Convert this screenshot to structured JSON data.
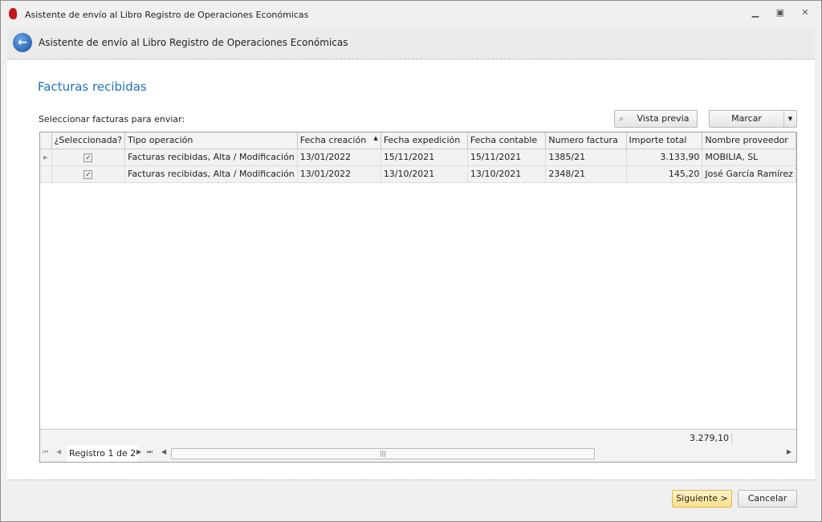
{
  "window": {
    "title": "Asistente de envío al Libro Registro de Operaciones Económicas",
    "minimize": "▁",
    "maximize": "▣",
    "close": "✕"
  },
  "header": {
    "title": "Asistente de envío al Libro Registro de Operaciones Económicas"
  },
  "section_title": "Facturas recibidas",
  "select_label": "Seleccionar facturas para enviar:",
  "toolbar": {
    "preview": "Vista previa",
    "mark": "Marcar"
  },
  "columns": [
    "¿Seleccionada?",
    "Tipo operación",
    "Fecha creación",
    "Fecha expedición",
    "Fecha contable",
    "Numero factura",
    "Importe total",
    "Nombre proveedor"
  ],
  "rows": [
    {
      "selected": true,
      "tipo": "Facturas recibidas, Alta / Modificación",
      "creacion": "13/01/2022",
      "expedicion": "15/11/2021",
      "contable": "15/11/2021",
      "numero": "1385/21",
      "importe": "3.133,90",
      "proveedor": "MOBILIA, SL"
    },
    {
      "selected": true,
      "tipo": "Facturas recibidas, Alta / Modificación",
      "creacion": "13/01/2022",
      "expedicion": "13/10/2021",
      "contable": "13/10/2021",
      "numero": "2348/21",
      "importe": "145,20",
      "proveedor": "José García Ramírez"
    }
  ],
  "total": "3.279,10",
  "nav": {
    "record": "Registro 1 de 2"
  },
  "buttons": {
    "next": "Siguiente >",
    "cancel": "Cancelar"
  }
}
